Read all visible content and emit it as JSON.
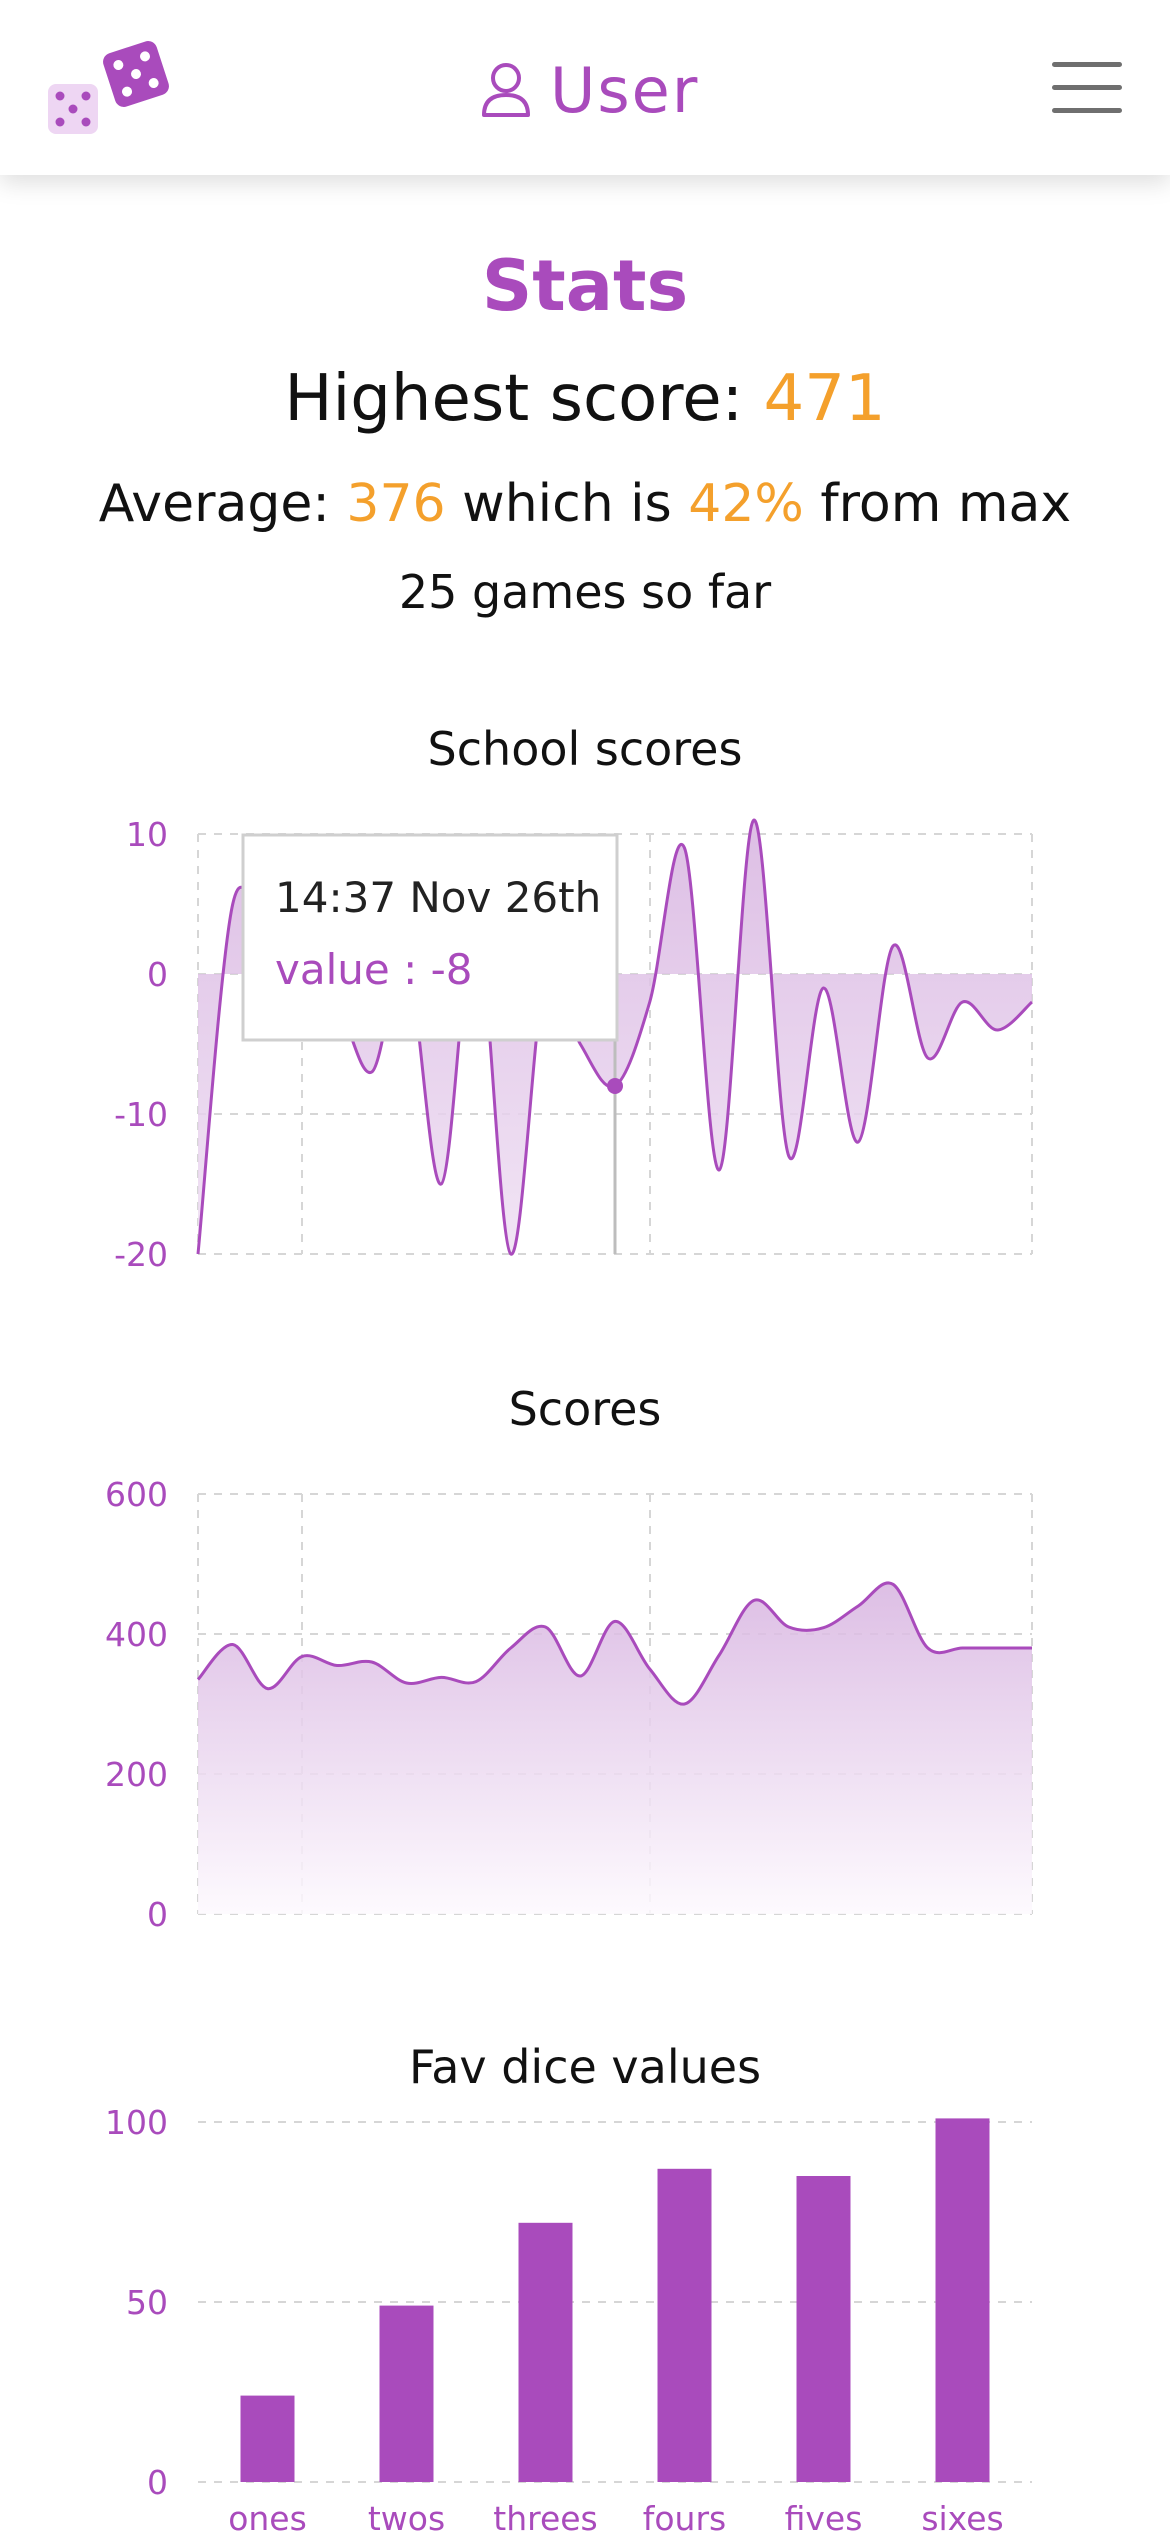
{
  "header": {
    "logo_icon": "dice-icon",
    "user_icon": "user-icon",
    "user_label": "User",
    "menu_icon": "hamburger-menu-icon"
  },
  "stats": {
    "title": "Stats",
    "highest_label": "Highest score: ",
    "highest_value": "471",
    "average_label": "Average: ",
    "average_value": "376",
    "average_middle": " which is ",
    "average_pct": "42%",
    "average_suffix": " from max",
    "games_text": "25 games so far"
  },
  "colors": {
    "accent": "#a94bbc",
    "highlight": "#f4a02c",
    "text": "#111111"
  },
  "chart_data": [
    {
      "type": "area",
      "title": "School scores",
      "ylim": [
        -20,
        10
      ],
      "yticks": [
        10,
        0,
        -10,
        -20
      ],
      "grid": true,
      "x": [
        0,
        1,
        2,
        3,
        4,
        5,
        6,
        7,
        8,
        9,
        10,
        11,
        12,
        13,
        14,
        15,
        16,
        17,
        18,
        19,
        20,
        21,
        22,
        23,
        24
      ],
      "values": [
        -20,
        5,
        2,
        0,
        -2,
        -7,
        1,
        -15,
        4,
        -20,
        0,
        -5,
        -8,
        -2,
        9,
        -14,
        11,
        -13,
        -1,
        -12,
        2,
        -6,
        -2,
        -4,
        -2
      ],
      "tooltip": {
        "time": "14:37 Nov 26th",
        "label": "value : -8",
        "index": 12
      }
    },
    {
      "type": "area",
      "title": "Scores",
      "ylim": [
        0,
        600
      ],
      "yticks": [
        600,
        400,
        200,
        0
      ],
      "grid": true,
      "x": [
        0,
        1,
        2,
        3,
        4,
        5,
        6,
        7,
        8,
        9,
        10,
        11,
        12,
        13,
        14,
        15,
        16,
        17,
        18,
        19,
        20,
        21,
        22,
        23,
        24
      ],
      "values": [
        335,
        385,
        322,
        368,
        355,
        360,
        330,
        338,
        332,
        380,
        410,
        340,
        418,
        350,
        300,
        370,
        448,
        410,
        409,
        440,
        471,
        380,
        380,
        380,
        380
      ]
    },
    {
      "type": "bar",
      "title": "Fav dice values",
      "ylim": [
        0,
        100
      ],
      "yticks": [
        100,
        50,
        0
      ],
      "grid": true,
      "categories": [
        "ones",
        "twos",
        "threes",
        "fours",
        "fives",
        "sixes"
      ],
      "values": [
        24,
        49,
        72,
        87,
        85,
        101
      ]
    }
  ]
}
